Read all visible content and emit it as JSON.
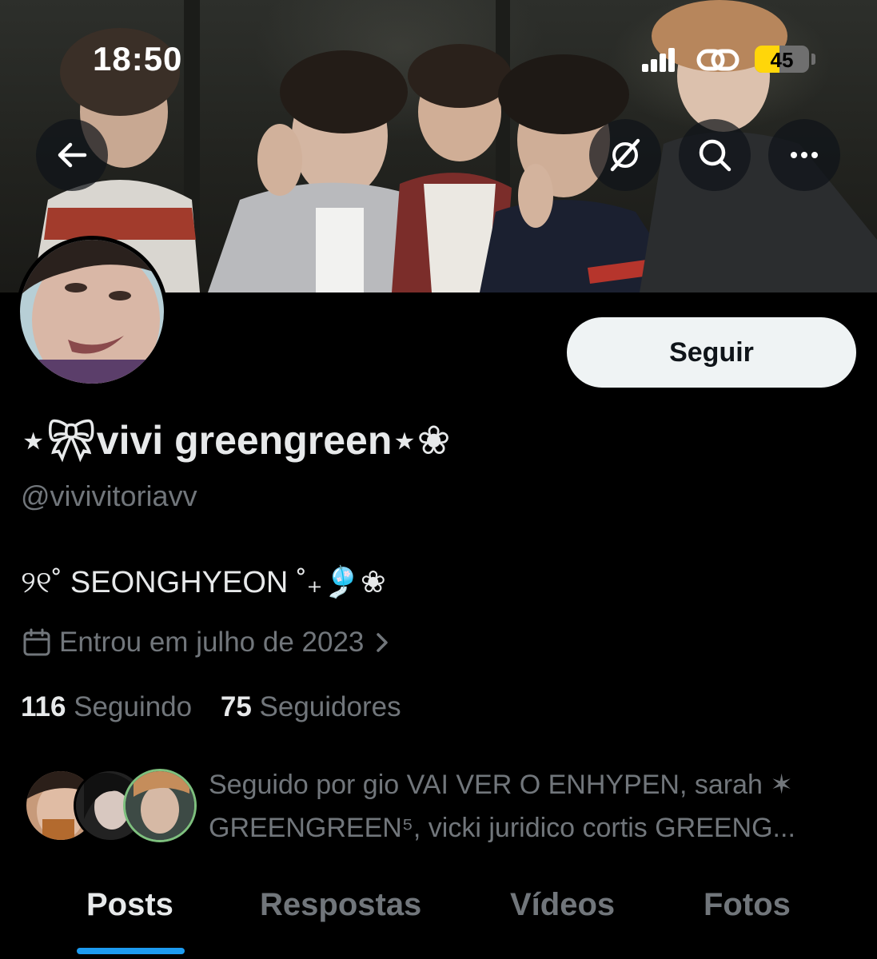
{
  "status_bar": {
    "time": "18:50",
    "battery": "45",
    "battery_level": 0.45
  },
  "banner": {
    "description": "group photo of five people"
  },
  "header_actions": {
    "back": "back-arrow-icon",
    "grok": "slashed-circle-icon",
    "search": "search-icon",
    "more": "more-icon"
  },
  "profile": {
    "display_name": "⋆🎀︎vivi greengreen⋆❀",
    "handle": "@vivivitoriavv",
    "bio": "୨୧˚ SEONGHYEON ˚₊🎐❀",
    "joined": "Entrou em julho de 2023",
    "following_count": "116",
    "following_label": "Seguindo",
    "followers_count": "75",
    "followers_label": "Seguidores",
    "follow_button": "Seguir",
    "followed_by_line1": "Seguido por gio VAI VER O ENHYPEN, sarah ✶",
    "followed_by_line2": "GREENGREEN⁵, vicki juridico cortis GREENG..."
  },
  "tabs": [
    {
      "label": "Posts",
      "active": true
    },
    {
      "label": "Respostas",
      "active": false
    },
    {
      "label": "Vídeos",
      "active": false
    },
    {
      "label": "Fotos",
      "active": false
    }
  ],
  "colors": {
    "accent": "#1d9bf0",
    "background": "#000000",
    "text_primary": "#e7e9ea",
    "text_secondary": "#71767b",
    "battery": "#ffd60a"
  }
}
